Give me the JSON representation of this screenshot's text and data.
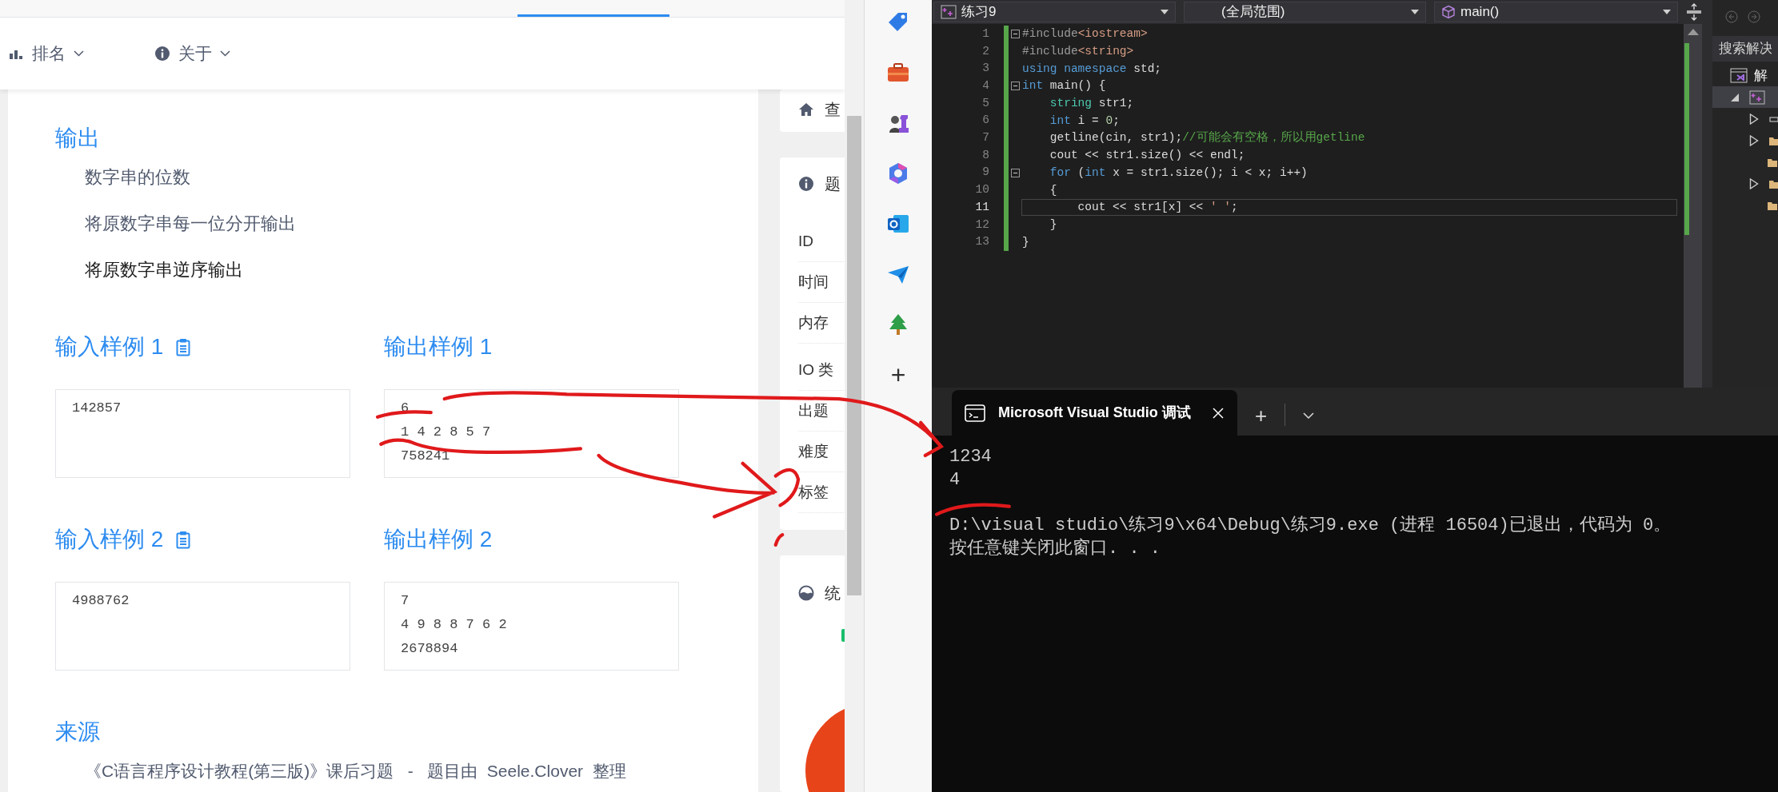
{
  "browser_page": {
    "nav": [
      {
        "label": "排名"
      },
      {
        "label": "关于"
      }
    ],
    "output_section": {
      "heading": "输出",
      "lines": [
        {
          "text": "数字串的位数",
          "hovered": false
        },
        {
          "text": "将原数字串每一位分开输出",
          "hovered": false
        },
        {
          "text": "将原数字串逆序输出",
          "hovered": true
        }
      ]
    },
    "samples": [
      {
        "input_heading": "输入样例 1",
        "input": "142857",
        "output_heading": "输出样例 1",
        "output": [
          "6",
          "1 4 2 8 5 7",
          "758241"
        ]
      },
      {
        "input_heading": "输入样例 2",
        "input": "4988762",
        "output_heading": "输出样例 2",
        "output": [
          "7",
          "4 9 8 8 7 6 2",
          "2678894"
        ]
      }
    ],
    "source": {
      "heading": "来源",
      "text": "《C语言程序设计教程(第三版)》课后习题   -   题目由  Seele.Clover  整理"
    },
    "sidebar": {
      "links_card": {
        "label": "查"
      },
      "info_card": {
        "title": "题",
        "row_groups": [
          [
            "ID",
            "时间",
            "内存"
          ],
          [
            "IO 类",
            "出题",
            "难度",
            "标签"
          ]
        ]
      },
      "stats_card": {
        "title": "统"
      }
    }
  },
  "dock": {
    "add_label": "+"
  },
  "editor": {
    "file_dropdown": "练习9",
    "scope_dropdown": "(全局范围)",
    "member_dropdown": "main()",
    "lines": [
      {
        "number": "1",
        "fold": true,
        "current": false,
        "tokens": [
          {
            "text": "#include",
            "kind": "pp"
          },
          {
            "text": "<iostream>",
            "kind": "str"
          }
        ]
      },
      {
        "number": "2",
        "fold": false,
        "current": false,
        "tokens": [
          {
            "text": "#include",
            "kind": "pp"
          },
          {
            "text": "<string>",
            "kind": "str"
          }
        ]
      },
      {
        "number": "3",
        "fold": false,
        "current": false,
        "tokens": [
          {
            "text": "using",
            "kind": "kw"
          },
          {
            "text": " namespace",
            "kind": "kw"
          },
          {
            "text": " std;",
            "kind": "plain"
          }
        ]
      },
      {
        "number": "4",
        "fold": true,
        "current": false,
        "tokens": [
          {
            "text": "int",
            "kind": "kw"
          },
          {
            "text": " main() {",
            "kind": "plain"
          }
        ]
      },
      {
        "number": "5",
        "fold": false,
        "current": false,
        "tokens": [
          {
            "text": "    string",
            "kind": "type"
          },
          {
            "text": " str1;",
            "kind": "plain"
          }
        ]
      },
      {
        "number": "6",
        "fold": false,
        "current": false,
        "tokens": [
          {
            "text": "    int",
            "kind": "kw"
          },
          {
            "text": " i = ",
            "kind": "plain"
          },
          {
            "text": "0",
            "kind": "num"
          },
          {
            "text": ";",
            "kind": "plain"
          }
        ]
      },
      {
        "number": "7",
        "fold": false,
        "current": false,
        "tokens": [
          {
            "text": "    getline(cin, str1);",
            "kind": "plain"
          },
          {
            "text": "//可能会有空格，所以用getline",
            "kind": "cmt"
          }
        ]
      },
      {
        "number": "8",
        "fold": false,
        "current": false,
        "tokens": [
          {
            "text": "    cout << str1.size() << endl;",
            "kind": "plain"
          }
        ]
      },
      {
        "number": "9",
        "fold": true,
        "current": false,
        "tokens": [
          {
            "text": "    for",
            "kind": "kw"
          },
          {
            "text": " (",
            "kind": "plain"
          },
          {
            "text": "int",
            "kind": "kw"
          },
          {
            "text": " x = str1.size(); i < x; i++)",
            "kind": "plain"
          }
        ]
      },
      {
        "number": "10",
        "fold": false,
        "current": false,
        "tokens": [
          {
            "text": "    {",
            "kind": "plain"
          }
        ]
      },
      {
        "number": "11",
        "fold": false,
        "current": true,
        "tokens": [
          {
            "text": "        cout << str1[x] << ",
            "kind": "plain"
          },
          {
            "text": "' '",
            "kind": "str"
          },
          {
            "text": ";",
            "kind": "plain"
          }
        ]
      },
      {
        "number": "12",
        "fold": false,
        "current": false,
        "tokens": [
          {
            "text": "    }",
            "kind": "plain"
          }
        ]
      },
      {
        "number": "13",
        "fold": false,
        "current": false,
        "tokens": [
          {
            "text": "}",
            "kind": "plain"
          }
        ]
      }
    ]
  },
  "solution_explorer": {
    "search_placeholder": "搜索解决",
    "solution_label": "解",
    "tree": [
      {
        "kind": "project",
        "expanded": true,
        "selected": true,
        "children": [
          {
            "kind": "references",
            "expander": true
          },
          {
            "kind": "folder",
            "expander": true
          },
          {
            "kind": "folder",
            "expander": false
          },
          {
            "kind": "folder",
            "expander": true
          },
          {
            "kind": "folder",
            "expander": false
          }
        ]
      }
    ]
  },
  "console": {
    "tab_title": "Microsoft Visual Studio 调试",
    "new_tab": "+",
    "program_output": [
      "1234",
      "4"
    ],
    "exit_message": [
      "D:\\visual studio\\练习9\\x64\\Debug\\练习9.exe (进程 16504)已退出，代码为 0。",
      "按任意键关闭此窗口. . ."
    ]
  }
}
